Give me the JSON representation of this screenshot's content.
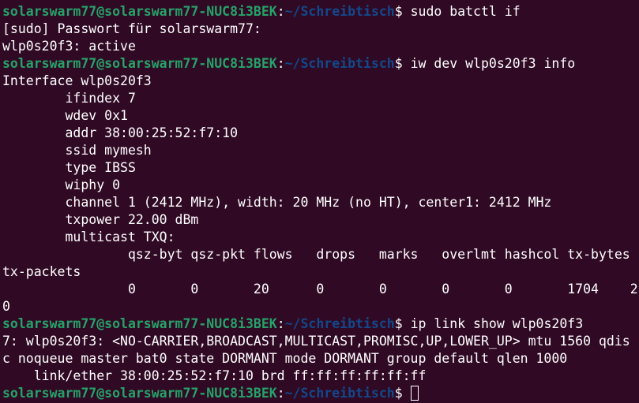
{
  "prompt": {
    "user_host": "solarswarm77@solarswarm77-NUC8i3BEK",
    "colon": ":",
    "path": "~/Schreibtisch",
    "dollar": "$ "
  },
  "colors": {
    "background": "#300a24",
    "user_host": "#26a269",
    "path": "#12488b",
    "text": "#ffffff"
  },
  "commands": {
    "c1": "sudo batctl if",
    "c2": "iw dev wlp0s20f3 info",
    "c3": "ip link show wlp0s20f3",
    "c4": ""
  },
  "output": {
    "l1": "[sudo] Passwort für solarswarm77:",
    "l2": "wlp0s20f3: active",
    "l3": "Interface wlp0s20f3",
    "l4": "        ifindex 7",
    "l5": "        wdev 0x1",
    "l6": "        addr 38:00:25:52:f7:10",
    "l7": "        ssid mymesh",
    "l8": "        type IBSS",
    "l9": "        wiphy 0",
    "l10": "        channel 1 (2412 MHz), width: 20 MHz (no HT), center1: 2412 MHz",
    "l11": "        txpower 22.00 dBm",
    "l12": "        multicast TXQ:",
    "l13": "                qsz-byt qsz-pkt flows   drops   marks   overlmt hashcol tx-bytes",
    "l14": "tx-packets",
    "l15": "                0       0       20      0       0       0       0       1704    2",
    "l16": "0",
    "l17": "7: wlp0s20f3: <NO-CARRIER,BROADCAST,MULTICAST,PROMISC,UP,LOWER_UP> mtu 1560 qdis",
    "l18": "c noqueue master bat0 state DORMANT mode DORMANT group default qlen 1000",
    "l19": "    link/ether 38:00:25:52:f7:10 brd ff:ff:ff:ff:ff:ff"
  }
}
